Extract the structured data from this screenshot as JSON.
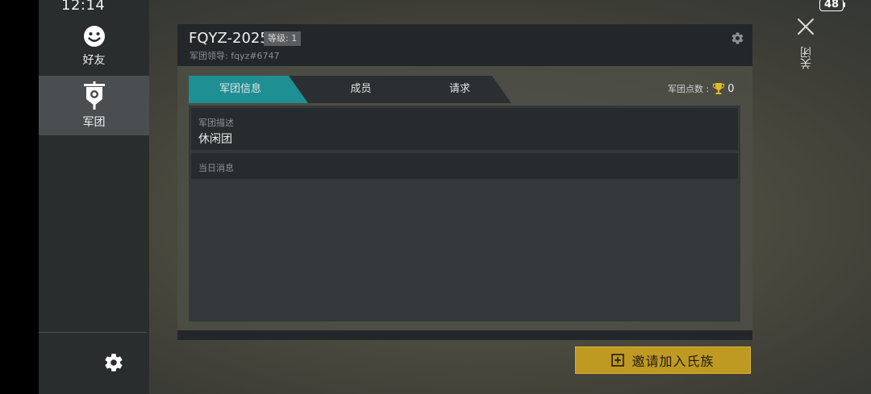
{
  "status_bar": {
    "time": "12:14",
    "battery": "48"
  },
  "sidebar": {
    "items": [
      {
        "label": "好友",
        "icon": "smiley-icon"
      },
      {
        "label": "军团",
        "icon": "legion-banner-icon",
        "selected": true
      }
    ],
    "settings_icon": "gear-icon"
  },
  "header": {
    "title": "FQYZ-2025",
    "level": "等级: 1",
    "leader": "军团领导: fqyz#6747",
    "settings_icon": "gear-icon"
  },
  "tabs": [
    {
      "label": "军团信息",
      "active": true
    },
    {
      "label": "成员",
      "active": false
    },
    {
      "label": "请求",
      "active": false
    }
  ],
  "points": {
    "label": "军团点数 :",
    "value": "0",
    "icon": "trophy-icon"
  },
  "description": {
    "label": "军团描述",
    "value": "休闲团"
  },
  "motd": {
    "label": "当日消息"
  },
  "invite_button": {
    "label": "邀请加入氏族",
    "icon": "plus-square-icon"
  },
  "close": {
    "label": "关闭",
    "icon": "close-icon"
  },
  "colors": {
    "accent_tab": "#1e8f93",
    "invite_button": "#bf9a22",
    "panel_dark": "#23272a",
    "trophy": "#e0b72a"
  }
}
